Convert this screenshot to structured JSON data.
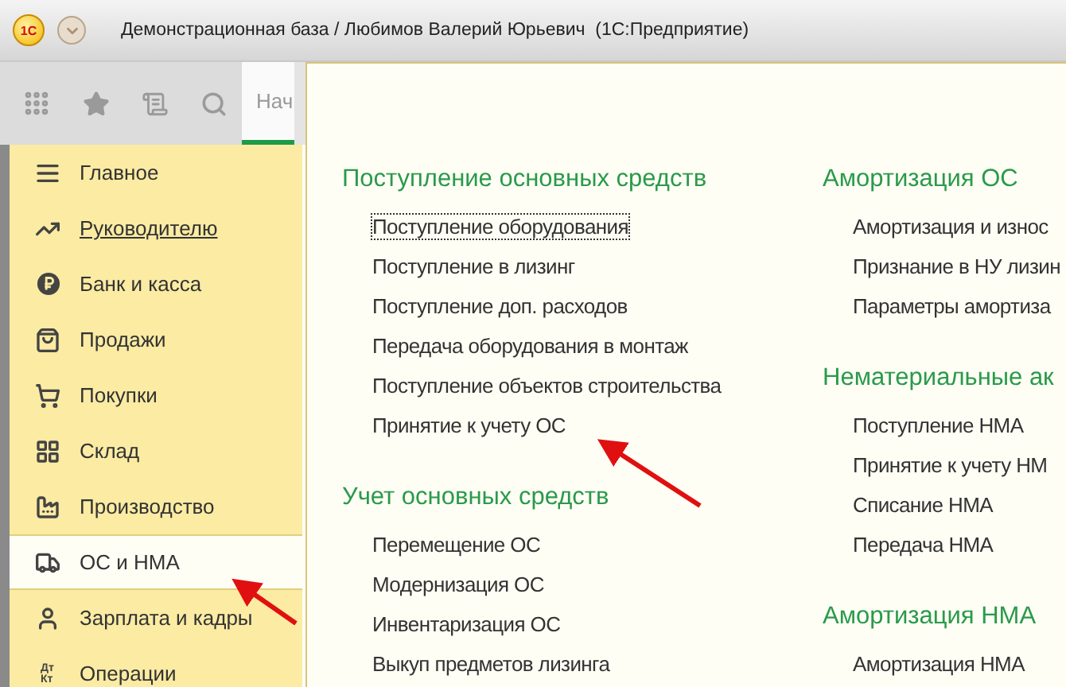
{
  "window": {
    "logo": "1С",
    "title": "Демонстрационная база / Любимов Валерий Юрьевич  (1С:Предприятие)"
  },
  "tabs": [
    {
      "label": "Нач",
      "selected": true
    }
  ],
  "sidebar": {
    "items": [
      {
        "kind": "lines",
        "label": "Главное",
        "selected": false,
        "hovered": false
      },
      {
        "kind": "trend",
        "label": "Руководителю",
        "selected": false,
        "hovered": true
      },
      {
        "kind": "coin",
        "label": "Банк и касса",
        "selected": false,
        "hovered": false
      },
      {
        "kind": "bag",
        "label": "Продажи",
        "selected": false,
        "hovered": false
      },
      {
        "kind": "cart",
        "label": "Покупки",
        "selected": false,
        "hovered": false
      },
      {
        "kind": "grid",
        "label": "Склад",
        "selected": false,
        "hovered": false
      },
      {
        "kind": "factory",
        "label": "Производство",
        "selected": false,
        "hovered": false
      },
      {
        "kind": "truck",
        "label": "ОС и НМА",
        "selected": true,
        "hovered": false
      },
      {
        "kind": "person",
        "label": "Зарплата и кадры",
        "selected": false,
        "hovered": false
      },
      {
        "kind": "ledger",
        "label": "Операции",
        "icon_text": "ДтКт",
        "selected": false,
        "hovered": false
      }
    ]
  },
  "panel": {
    "columns": [
      [
        {
          "title": "Поступление основных средств",
          "items": [
            {
              "label": "Поступление оборудования",
              "focused": true
            },
            {
              "label": "Поступление в лизинг",
              "focused": false
            },
            {
              "label": "Поступление доп. расходов",
              "focused": false
            },
            {
              "label": "Передача оборудования в монтаж",
              "focused": false
            },
            {
              "label": "Поступление объектов строительства",
              "focused": false
            },
            {
              "label": "Принятие к учету ОС",
              "focused": false
            }
          ]
        },
        {
          "title": "Учет основных средств",
          "items": [
            {
              "label": "Перемещение ОС",
              "focused": false
            },
            {
              "label": "Модернизация ОС",
              "focused": false
            },
            {
              "label": "Инвентаризация ОС",
              "focused": false
            },
            {
              "label": "Выкуп предметов лизинга",
              "focused": false
            }
          ]
        }
      ],
      [
        {
          "title": "Амортизация ОС",
          "items": [
            {
              "label": "Амортизация и износ",
              "focused": false
            },
            {
              "label": "Признание в НУ лизин",
              "focused": false
            },
            {
              "label": "Параметры амортиза",
              "focused": false
            }
          ]
        },
        {
          "title": "Нематериальные ак",
          "items": [
            {
              "label": "Поступление НМА",
              "focused": false
            },
            {
              "label": "Принятие к учету НМ",
              "focused": false
            },
            {
              "label": "Списание НМА",
              "focused": false
            },
            {
              "label": "Передача НМА",
              "focused": false
            }
          ]
        },
        {
          "title": "Амортизация НМА",
          "items": [
            {
              "label": "Амортизация НМА",
              "focused": false
            }
          ]
        }
      ]
    ]
  }
}
